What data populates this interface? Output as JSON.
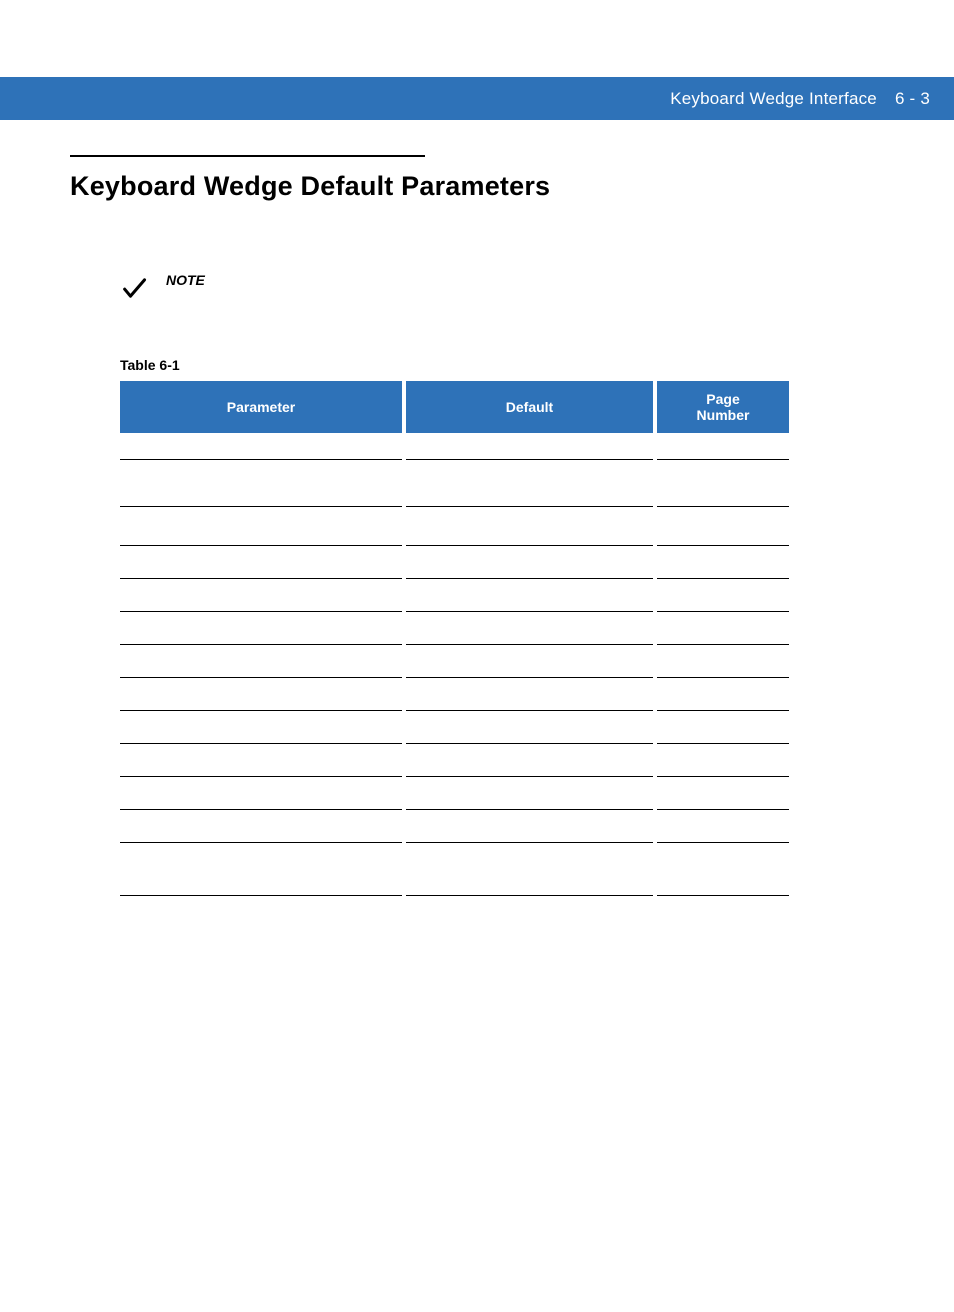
{
  "header": {
    "chapter_title": "Keyboard Wedge Interface",
    "page_label": "6 - 3"
  },
  "section": {
    "title": "Keyboard Wedge Default Parameters"
  },
  "note": {
    "icon": "check-icon",
    "label": "NOTE"
  },
  "table": {
    "caption": "Table 6-1",
    "columns": {
      "parameter": "Parameter",
      "default": "Default",
      "page_number": "Page\nNumber"
    },
    "rows": [
      {
        "parameter": "",
        "default": "",
        "page_number": "",
        "size": "tall"
      },
      {
        "parameter": "",
        "default": "",
        "page_number": "",
        "size": "med"
      },
      {
        "parameter": "",
        "default": "",
        "page_number": "",
        "size": "norm"
      },
      {
        "parameter": "",
        "default": "",
        "page_number": "",
        "size": "norm"
      },
      {
        "parameter": "",
        "default": "",
        "page_number": "",
        "size": "norm"
      },
      {
        "parameter": "",
        "default": "",
        "page_number": "",
        "size": "norm"
      },
      {
        "parameter": "",
        "default": "",
        "page_number": "",
        "size": "norm"
      },
      {
        "parameter": "",
        "default": "",
        "page_number": "",
        "size": "norm"
      },
      {
        "parameter": "",
        "default": "",
        "page_number": "",
        "size": "norm"
      },
      {
        "parameter": "",
        "default": "",
        "page_number": "",
        "size": "norm"
      },
      {
        "parameter": "",
        "default": "",
        "page_number": "",
        "size": "norm"
      },
      {
        "parameter": "",
        "default": "",
        "page_number": "",
        "size": "last"
      }
    ]
  }
}
